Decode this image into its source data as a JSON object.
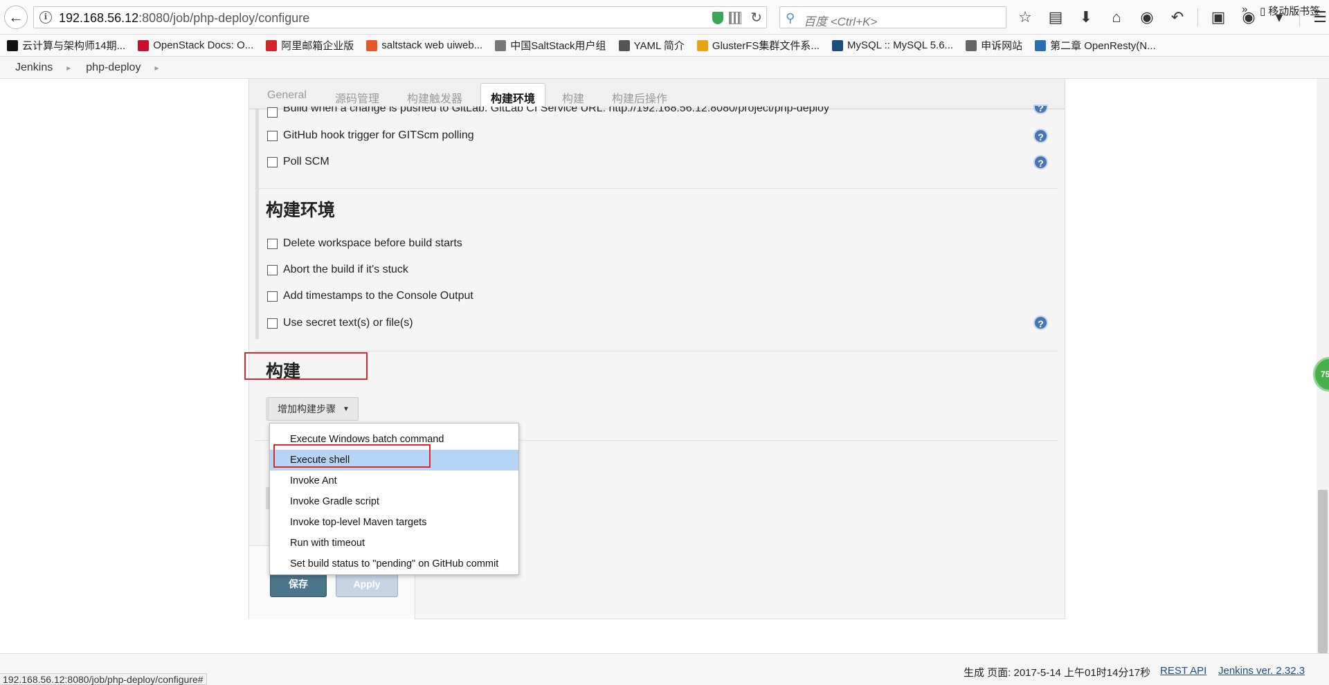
{
  "browser": {
    "url_host": "192.168.56.12",
    "url_rest": ":8080/job/php-deploy/configure",
    "search_placeholder": "百度 <Ctrl+K>",
    "bookmarks": [
      {
        "label": "云计算与架构师14期...",
        "color": "#111111"
      },
      {
        "label": "OpenStack Docs: O...",
        "color": "#c8102e"
      },
      {
        "label": "阿里邮箱企业版",
        "color": "#d2232a"
      },
      {
        "label": "saltstack web uiweb...",
        "color": "#e8562a"
      },
      {
        "label": "中国SaltStack用户组",
        "color": "#777777"
      },
      {
        "label": "YAML 简介",
        "color": "#555555"
      },
      {
        "label": "GlusterFS集群文件系...",
        "color": "#e8a317"
      },
      {
        "label": "MySQL :: MySQL 5.6...",
        "color": "#1c4e80"
      },
      {
        "label": "申诉网站",
        "color": "#666666"
      },
      {
        "label": "第二章 OpenResty(N...",
        "color": "#2a6db5"
      }
    ],
    "bookmarks_overflow": "»",
    "mobile_bookmarks": "移动版书签"
  },
  "breadcrumb": {
    "items": [
      "Jenkins",
      "php-deploy"
    ]
  },
  "tabs": [
    {
      "label": "General",
      "active": false
    },
    {
      "label": "源码管理",
      "active": false
    },
    {
      "label": "构建触发器",
      "active": false
    },
    {
      "label": "构建环境",
      "active": true
    },
    {
      "label": "构建",
      "active": false
    },
    {
      "label": "构建后操作",
      "active": false
    }
  ],
  "triggers": [
    {
      "label": "Build when a change is pushed to GitLab. GitLab CI Service URL: http://192.168.56.12:8080/project/php-deploy",
      "help": true
    },
    {
      "label": "GitHub hook trigger for GITScm polling",
      "help": true
    },
    {
      "label": "Poll SCM",
      "help": true
    }
  ],
  "build_env": {
    "title": "构建环境",
    "options": [
      {
        "label": "Delete workspace before build starts",
        "help": false
      },
      {
        "label": "Abort the build if it's stuck",
        "help": false
      },
      {
        "label": "Add timestamps to the Console Output",
        "help": false
      },
      {
        "label": "Use secret text(s) or file(s)",
        "help": true
      }
    ]
  },
  "build": {
    "title": "构建",
    "add_step_label": "增加构建步骤",
    "menu_items": [
      "Execute Windows batch command",
      "Execute shell",
      "Invoke Ant",
      "Invoke Gradle script",
      "Invoke top-level Maven targets",
      "Run with timeout",
      "Set build status to \"pending\" on GitHub commit"
    ],
    "highlighted_item": "Execute shell"
  },
  "buttons": {
    "save": "保存",
    "apply": "Apply"
  },
  "footer": {
    "generated": "生成 页面: 2017-5-14 上午01时14分17秒",
    "rest_api": "REST API",
    "version": "Jenkins ver. 2.32.3"
  },
  "status_url": "192.168.56.12:8080/job/php-deploy/configure#",
  "badge_text": "75",
  "colors": {
    "highlight": "#b6d4f4",
    "annotation_red": "#e0262b",
    "help_blue": "#4a75b3"
  }
}
